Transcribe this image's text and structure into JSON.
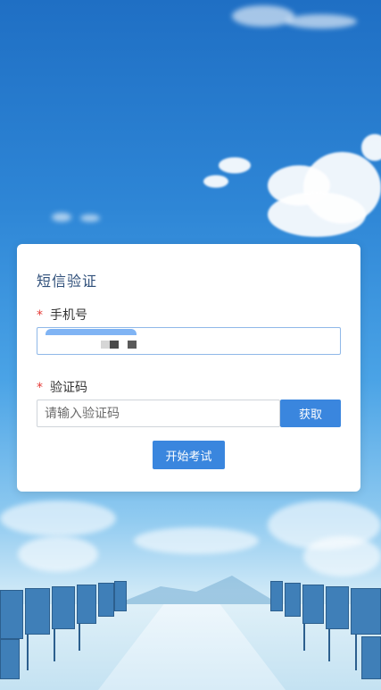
{
  "form": {
    "title": "短信验证",
    "phone": {
      "required_mark": "*",
      "label": "手机号",
      "value": ""
    },
    "code": {
      "required_mark": "*",
      "label": "验证码",
      "placeholder": "请输入验证码"
    },
    "get_code_button": "获取",
    "start_exam_button": "开始考试"
  },
  "colors": {
    "primary": "#3a86de",
    "required": "#e53935",
    "title": "#2f4f7a"
  }
}
